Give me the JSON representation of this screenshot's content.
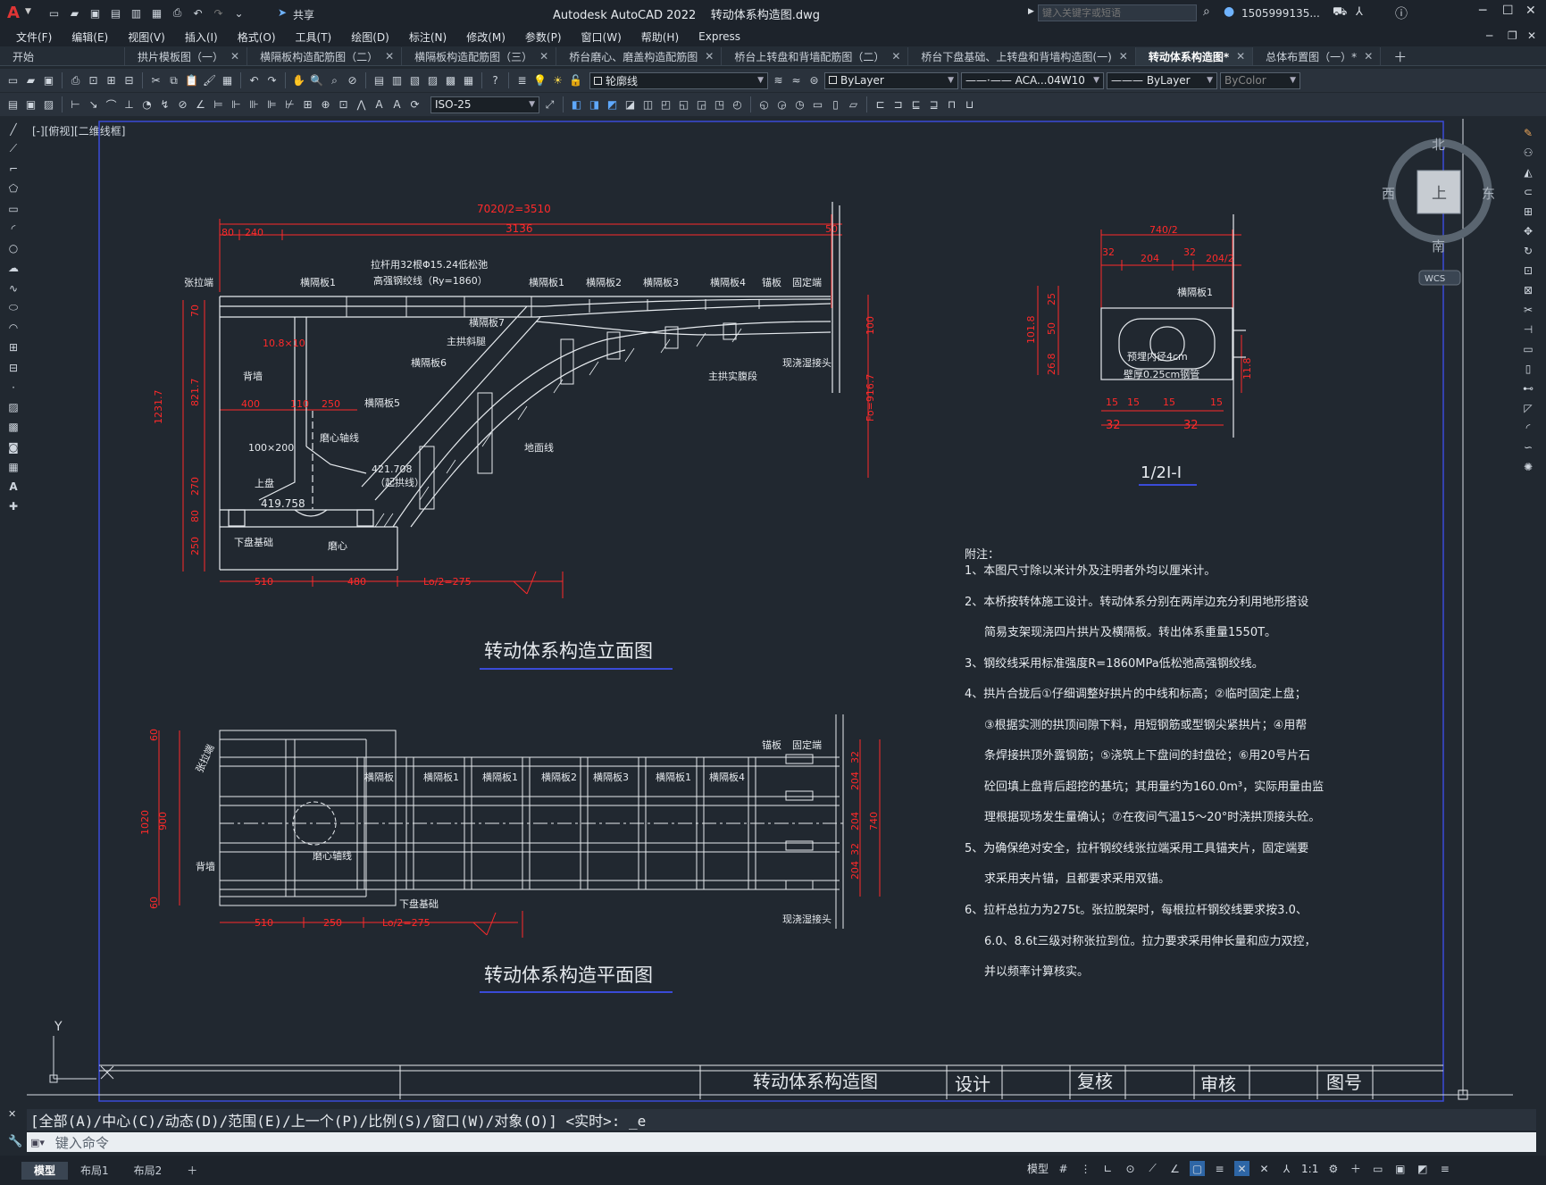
{
  "app": {
    "title": "Autodesk AutoCAD 2022",
    "filename": "转动体系构造图.dwg",
    "search_placeholder": "键入关键字或短语",
    "user": "1505999135...",
    "share": "共享"
  },
  "menu": [
    "文件(F)",
    "编辑(E)",
    "视图(V)",
    "插入(I)",
    "格式(O)",
    "工具(T)",
    "绘图(D)",
    "标注(N)",
    "修改(M)",
    "参数(P)",
    "窗口(W)",
    "帮助(H)",
    "Express"
  ],
  "tabs": [
    {
      "label": "开始",
      "active": false
    },
    {
      "label": "拱片模板图（一）",
      "active": false
    },
    {
      "label": "横隔板构造配筋图（二）",
      "active": false
    },
    {
      "label": "横隔板构造配筋图（三）",
      "active": false
    },
    {
      "label": "桥台磨心、磨盖构造配筋图",
      "active": false
    },
    {
      "label": "桥台上转盘和背墙配筋图（二）",
      "active": false
    },
    {
      "label": "桥台下盘基础、上转盘和背墙构造图(一)",
      "active": false
    },
    {
      "label": "转动体系构造图*",
      "active": true
    },
    {
      "label": "总体布置图（一）*",
      "active": false
    }
  ],
  "toolbar": {
    "layer": "轮廓线",
    "color": "ByLayer",
    "linetype": "ACA...04W10",
    "lineweight": "ByLayer",
    "plotstyle": "ByColor",
    "dimstyle": "ISO-25"
  },
  "viewport": {
    "label": "[-][俯视][二维线框]",
    "compass": {
      "n": "北",
      "s": "南",
      "e": "东",
      "w": "西",
      "center": "上",
      "wcs": "WCS"
    },
    "axis_y": "Y",
    "axis_x": "X"
  },
  "drawing": {
    "elevation_title": "转动体系构造立面图",
    "plan_title": "转动体系构造平面图",
    "section_title": "1/2Ⅰ-Ⅰ",
    "elev_labels": {
      "top_dim": "7020/2=3510",
      "dim_3136": "3136",
      "dim_80": "80",
      "dim_240": "240",
      "dim_50": "50",
      "tension": "拉杆用32根Φ15.24低松弛",
      "tension2": "高强钢绞线（Ry=1860）",
      "zhangladuan": "张拉端",
      "hgb1a": "横隔板1",
      "hgb1b": "横隔板1",
      "hgb2": "横隔板2",
      "hgb3": "横隔板3",
      "hgb4": "横隔板4",
      "maoban": "锚板",
      "guding": "固定端",
      "hgb7": "横隔板7",
      "zhugongxie": "主拱斜腿",
      "hgb6": "横隔板6",
      "hgb5": "横隔板5",
      "zhugongshi": "主拱实腹段",
      "xianjiao": "现浇湿接头",
      "beiqiang": "背墙",
      "mo1": "10.8×10",
      "d400": "400",
      "d110": "110",
      "d250": "250",
      "d100x200": "100×200",
      "moxin": "磨心轴线",
      "h421": "421.708",
      "qigong": "（起拱线）",
      "shangpan": "上盘",
      "h419": "419.758",
      "xiapan": "下盘基础",
      "moxin2": "磨心",
      "dimian": "地面线",
      "v1231": "1231.7",
      "v70": "70",
      "v821": "821.7",
      "v270": "270",
      "v80": "80",
      "v250": "250",
      "v100": "100",
      "fo": "Fo=916.7",
      "b510": "510",
      "b480": "480",
      "lo": "Lo/2=275"
    },
    "plan_labels": {
      "zhangladuan": "张拉端",
      "beiqiang": "背墙",
      "moxin": "磨心轴线",
      "xiapan": "下盘基础",
      "maoban": "锚板",
      "guding": "固定端",
      "xianjiao": "现浇湿接头",
      "hgb": [
        "横隔板",
        "横隔板1",
        "横隔板1",
        "横隔板2",
        "横隔板3",
        "横隔板1",
        "横隔板4"
      ],
      "v60a": "60",
      "v1020": "1020",
      "v900": "900",
      "v60b": "60",
      "r32a": "32",
      "r204a": "204",
      "r204b": "204",
      "r740": "740",
      "r32b": "32",
      "r204c": "204",
      "b510": "510",
      "b250": "250",
      "lo": "Lo/2=275"
    },
    "section_labels": {
      "d740": "740/2",
      "d32a": "32",
      "d204": "204",
      "d32b": "32",
      "d2042": "204/2",
      "hgb1": "横隔板1",
      "v25": "25",
      "v50": "50",
      "v1018": "101.8",
      "v268": "26.8",
      "pipe1": "预埋内径4cm",
      "pipe2": "壁厚0.25cm钢管",
      "v118": "11.8",
      "s15a": "15",
      "s15b": "15",
      "s15c": "15",
      "s15d": "15",
      "s32a": "32",
      "s32b": "32"
    },
    "notes_title": "附注：",
    "notes": [
      "1、本图尺寸除以米计外及注明者外均以厘米计。",
      "2、本桥按转体施工设计。转动体系分别在两岸边充分利用地形搭设",
      "简易支架现浇四片拱片及横隔板。转出体系重量1550T。",
      "3、钢绞线采用标准强度R=1860MPa低松弛高强钢绞线。",
      "4、拱片合拢后①仔细调整好拱片的中线和标高；②临时固定上盘；",
      "③根据实测的拱顶间隙下料，用短钢筋或型钢尖紧拱片；④用帮",
      "条焊接拱顶外露钢筋；⑤浇筑上下盘间的封盘砼；⑥用20号片石",
      "砼回填上盘背后超挖的基坑；其用量约为160.0m³，实际用量由监",
      "理根据现场发生量确认；⑦在夜间气温15～20°时浇拱顶接头砼。",
      "5、为确保绝对安全，拉杆钢绞线张拉端采用工具锚夹片，固定端要",
      "求采用夹片锚，且都要求采用双锚。",
      "6、拉杆总拉力为275t。张拉脱架时，每根拉杆钢绞线要求按3.0、",
      "6.0、8.6t三级对称张拉到位。拉力要求采用伸长量和应力双控，",
      "并以频率计算核实。"
    ],
    "titleblock": {
      "name": "转动体系构造图",
      "design": "设计",
      "check": "复核",
      "review": "审核",
      "number": "图号"
    }
  },
  "command": {
    "history": "[全部(A)/中心(C)/动态(D)/范围(E)/上一个(P)/比例(S)/窗口(W)/对象(O)] <实时>: _e",
    "placeholder": "键入命令"
  },
  "layouts": [
    "模型",
    "布局1",
    "布局2"
  ],
  "status": {
    "model": "模型",
    "scale": "1:1"
  }
}
